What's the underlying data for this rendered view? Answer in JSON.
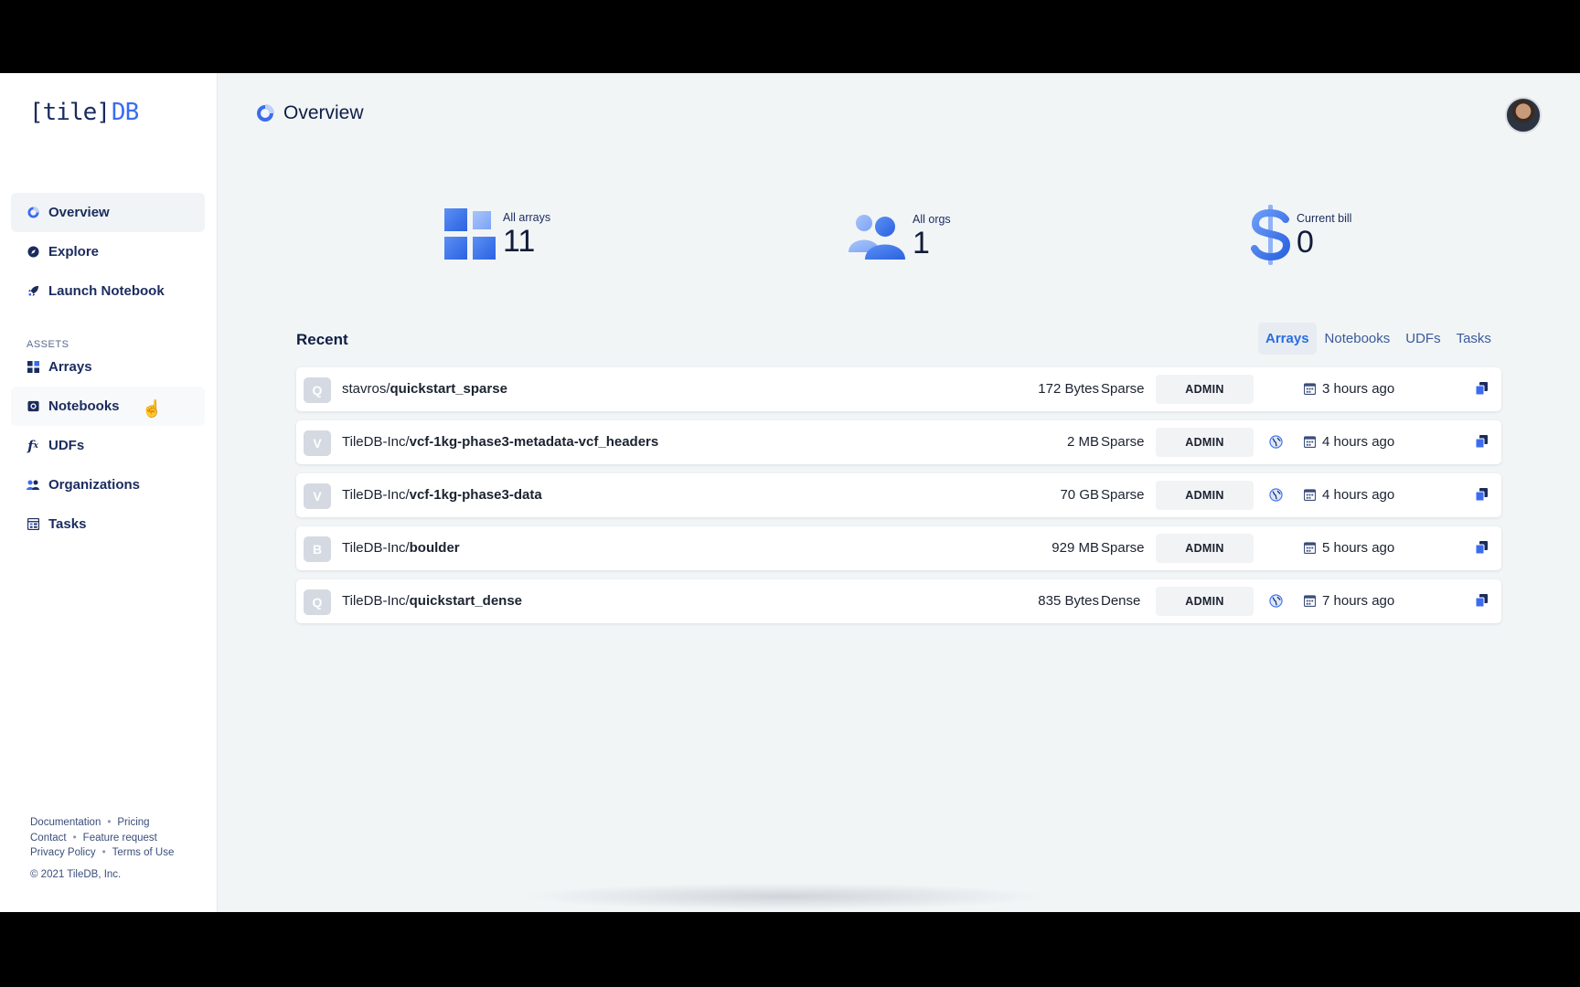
{
  "logo": {
    "bracket_text": "[tile]",
    "db_text": "DB"
  },
  "nav": {
    "items": [
      {
        "label": "Overview",
        "icon": "pie-icon",
        "active": true
      },
      {
        "label": "Explore",
        "icon": "compass-icon"
      },
      {
        "label": "Launch Notebook",
        "icon": "rocket-icon"
      }
    ],
    "section_label": "ASSETS",
    "asset_items": [
      {
        "label": "Arrays",
        "icon": "grid-icon"
      },
      {
        "label": "Notebooks",
        "icon": "notebook-icon"
      },
      {
        "label": "UDFs",
        "icon": "function-icon"
      },
      {
        "label": "Organizations",
        "icon": "people-icon"
      },
      {
        "label": "Tasks",
        "icon": "tasks-icon"
      }
    ]
  },
  "footer": {
    "documentation": "Documentation",
    "pricing": "Pricing",
    "contact": "Contact",
    "feature_request": "Feature request",
    "privacy": "Privacy Policy",
    "terms": "Terms of Use",
    "copyright": "© 2021 TileDB, Inc."
  },
  "header": {
    "title": "Overview"
  },
  "stats": {
    "arrays": {
      "label": "All arrays",
      "value": "11"
    },
    "orgs": {
      "label": "All orgs",
      "value": "1"
    },
    "bill": {
      "label": "Current bill",
      "value": "0"
    }
  },
  "recent": {
    "title": "Recent",
    "tabs": [
      "Arrays",
      "Notebooks",
      "UDFs",
      "Tasks"
    ],
    "active_tab": "Arrays",
    "rows": [
      {
        "badge": "Q",
        "owner": "stavros/",
        "name": "quickstart_sparse",
        "size": "172 Bytes",
        "type": "Sparse",
        "role": "ADMIN",
        "public": false,
        "time": "3 hours ago"
      },
      {
        "badge": "V",
        "owner": "TileDB-Inc/",
        "name": "vcf-1kg-phase3-metadata-vcf_headers",
        "size": "2 MB",
        "type": "Sparse",
        "role": "ADMIN",
        "public": true,
        "time": "4 hours ago"
      },
      {
        "badge": "V",
        "owner": "TileDB-Inc/",
        "name": "vcf-1kg-phase3-data",
        "size": "70 GB",
        "type": "Sparse",
        "role": "ADMIN",
        "public": true,
        "time": "4 hours ago"
      },
      {
        "badge": "B",
        "owner": "TileDB-Inc/",
        "name": "boulder",
        "size": "929 MB",
        "type": "Sparse",
        "role": "ADMIN",
        "public": false,
        "time": "5 hours ago"
      },
      {
        "badge": "Q",
        "owner": "TileDB-Inc/",
        "name": "quickstart_dense",
        "size": "835 Bytes",
        "type": "Dense",
        "role": "ADMIN",
        "public": true,
        "time": "7 hours ago"
      }
    ]
  },
  "colors": {
    "accent": "#2b6de0",
    "navy": "#1a2b5e",
    "background": "#f2f5f6"
  }
}
